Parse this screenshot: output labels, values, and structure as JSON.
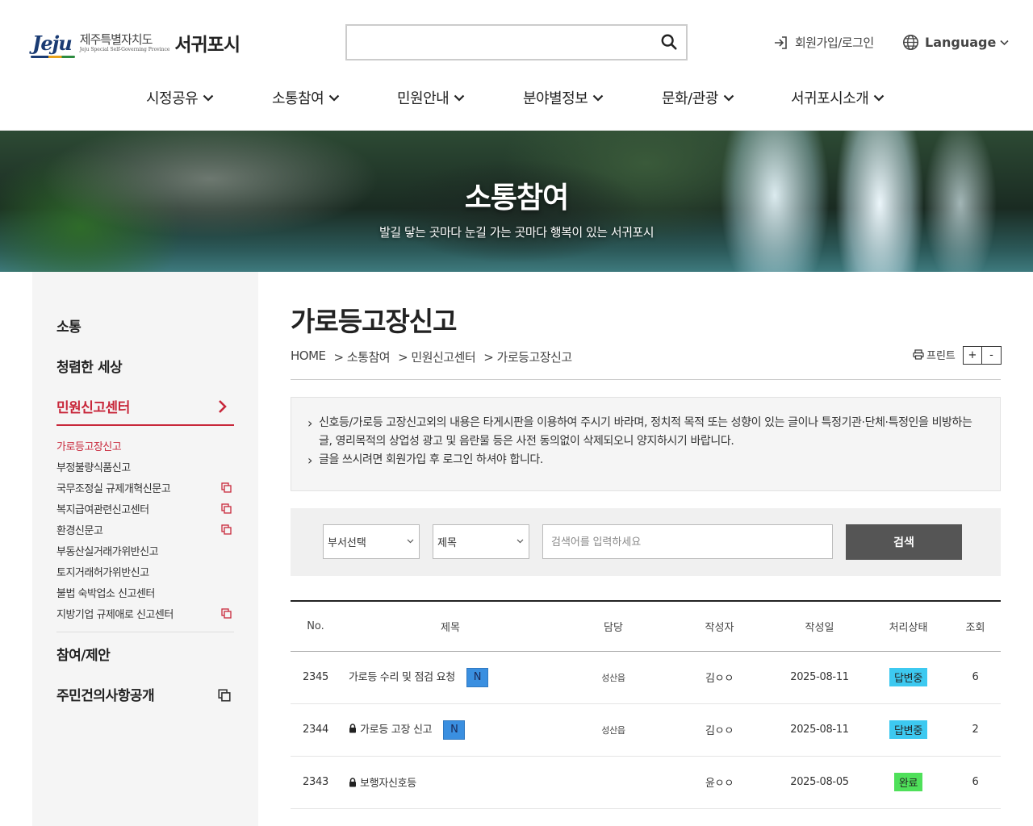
{
  "header": {
    "logo_brand": "Jeju",
    "logo_sub": "제주특별자치도",
    "logo_en": "Jeju Special Self-Governing Province",
    "logo_city": "서귀포시",
    "search_placeholder": "",
    "login_label": "회원가입/로그인",
    "language_label": "Language"
  },
  "gnb": [
    {
      "label": "시정공유"
    },
    {
      "label": "소통참여"
    },
    {
      "label": "민원안내"
    },
    {
      "label": "분야별정보"
    },
    {
      "label": "문화/관광"
    },
    {
      "label": "서귀포시소개"
    }
  ],
  "banner": {
    "title": "소통참여",
    "subtitle": "발길 닿는 곳마다 눈길 가는 곳마다 행복이 있는 서귀포시"
  },
  "sidebar": {
    "items": [
      {
        "label": "소통"
      },
      {
        "label": "청렴한 세상"
      },
      {
        "label": "민원신고센터"
      },
      {
        "label": "참여/제안"
      },
      {
        "label": "주민건의사항공개"
      }
    ],
    "sub_items": [
      {
        "label": "가로등고장신고"
      },
      {
        "label": "부정불량식품신고"
      },
      {
        "label": "국무조정실 규제개혁신문고"
      },
      {
        "label": "복지급여관련신고센터"
      },
      {
        "label": "환경신문고"
      },
      {
        "label": "부동산실거래가위반신고"
      },
      {
        "label": "토지거래허가위반신고"
      },
      {
        "label": "불법 숙박업소 신고센터"
      },
      {
        "label": "지방기업 규제애로 신고센터"
      }
    ]
  },
  "content": {
    "title": "가로등고장신고",
    "breadcrumb": [
      "HOME",
      "> 소통참여",
      "> 민원신고센터",
      "> 가로등고장신고"
    ],
    "print_label": "프린트",
    "zoom_in": "+",
    "zoom_out": "-",
    "notice": [
      "신호등/가로등 고장신고외의 내용은 타게시판을 이용하여 주시기 바라며, 정치적 목적 또는 성향이 있는 글이나 특정기관·단체·특정인을 비방하는 글, 영리목적의 상업성 광고 및 음란물 등은 사전 동의없이 삭제되오니 양지하시기 바랍니다.",
      "글을 쓰시려면 회원가입 후 로그인 하셔야 합니다."
    ]
  },
  "search": {
    "dept_select": "부서선택",
    "field_select": "제목",
    "keyword_placeholder": "검색어를 입력하세요",
    "button_label": "검색"
  },
  "table": {
    "headers": [
      "No.",
      "제목",
      "담당",
      "작성자",
      "작성일",
      "처리상태",
      "조회"
    ],
    "rows": [
      {
        "no": "2345",
        "title": "가로등 수리 및 점검 요청",
        "locked": false,
        "is_new": true,
        "new_label": "N",
        "dept": "성산읍",
        "author": "김ㅇㅇ",
        "date": "2025-08-11",
        "status": "답변중",
        "views": "6"
      },
      {
        "no": "2344",
        "title": "가로등 고장 신고",
        "locked": true,
        "is_new": true,
        "new_label": "N",
        "dept": "성산읍",
        "author": "김ㅇㅇ",
        "date": "2025-08-11",
        "status": "답변중",
        "views": "2"
      },
      {
        "no": "2343",
        "title": "보행자신호등",
        "locked": true,
        "is_new": false,
        "new_label": "",
        "dept": "",
        "author": "윤ㅇㅇ",
        "date": "2025-08-05",
        "status": "완료",
        "views": "6"
      }
    ]
  },
  "colors": {
    "accent": "#c8283b",
    "status_in_progress": "#3dc9f0",
    "status_done": "#4fe05a",
    "new_badge": "#3a8fe0"
  }
}
